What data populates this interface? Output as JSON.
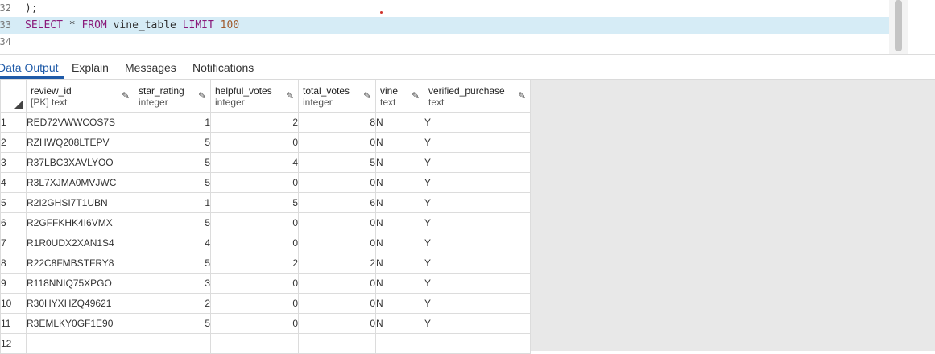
{
  "editor": {
    "lines": [
      {
        "number": "32",
        "text": ");"
      },
      {
        "number": "33",
        "keyword_select": "SELECT",
        "star": "*",
        "keyword_from": "FROM",
        "table": "vine_table",
        "keyword_limit": "LIMIT",
        "limit_value": "100"
      },
      {
        "number": "34",
        "text": ""
      }
    ]
  },
  "tabs": [
    {
      "label": "Data Output",
      "active": true
    },
    {
      "label": "Explain"
    },
    {
      "label": "Messages"
    },
    {
      "label": "Notifications"
    }
  ],
  "columns": [
    {
      "name": "review_id",
      "type": "[PK] text"
    },
    {
      "name": "star_rating",
      "type": "integer"
    },
    {
      "name": "helpful_votes",
      "type": "integer"
    },
    {
      "name": "total_votes",
      "type": "integer"
    },
    {
      "name": "vine",
      "type": "text"
    },
    {
      "name": "verified_purchase",
      "type": "text"
    }
  ],
  "rows": [
    [
      "1",
      "RED72VWWCOS7S",
      "1",
      "2",
      "8",
      "N",
      "Y"
    ],
    [
      "2",
      "RZHWQ208LTEPV",
      "5",
      "0",
      "0",
      "N",
      "Y"
    ],
    [
      "3",
      "R37LBC3XAVLYOO",
      "5",
      "4",
      "5",
      "N",
      "Y"
    ],
    [
      "4",
      "R3L7XJMA0MVJWC",
      "5",
      "0",
      "0",
      "N",
      "Y"
    ],
    [
      "5",
      "R2I2GHSI7T1UBN",
      "1",
      "5",
      "6",
      "N",
      "Y"
    ],
    [
      "6",
      "R2GFFKHK4I6VMX",
      "5",
      "0",
      "0",
      "N",
      "Y"
    ],
    [
      "7",
      "R1R0UDX2XAN1S4",
      "4",
      "0",
      "0",
      "N",
      "Y"
    ],
    [
      "8",
      "R22C8FMBSTFRY8",
      "5",
      "2",
      "2",
      "N",
      "Y"
    ],
    [
      "9",
      "R118NNIQ75XPGO",
      "3",
      "0",
      "0",
      "N",
      "Y"
    ],
    [
      "10",
      "R30HYXHZQ49621",
      "2",
      "0",
      "0",
      "N",
      "Y"
    ],
    [
      "11",
      "R3EMLKY0GF1E90",
      "5",
      "0",
      "0",
      "N",
      "Y"
    ],
    [
      "12",
      "",
      "",
      "",
      "",
      "",
      ""
    ]
  ],
  "icons": {
    "edit_column": "pencil-icon",
    "select_all": "corner-triangle-icon"
  },
  "colors": {
    "active_line": "#d6ecf6",
    "accent": "#1e5aa8",
    "keyword": "#8a1a7a",
    "number": "#a05a2c"
  }
}
